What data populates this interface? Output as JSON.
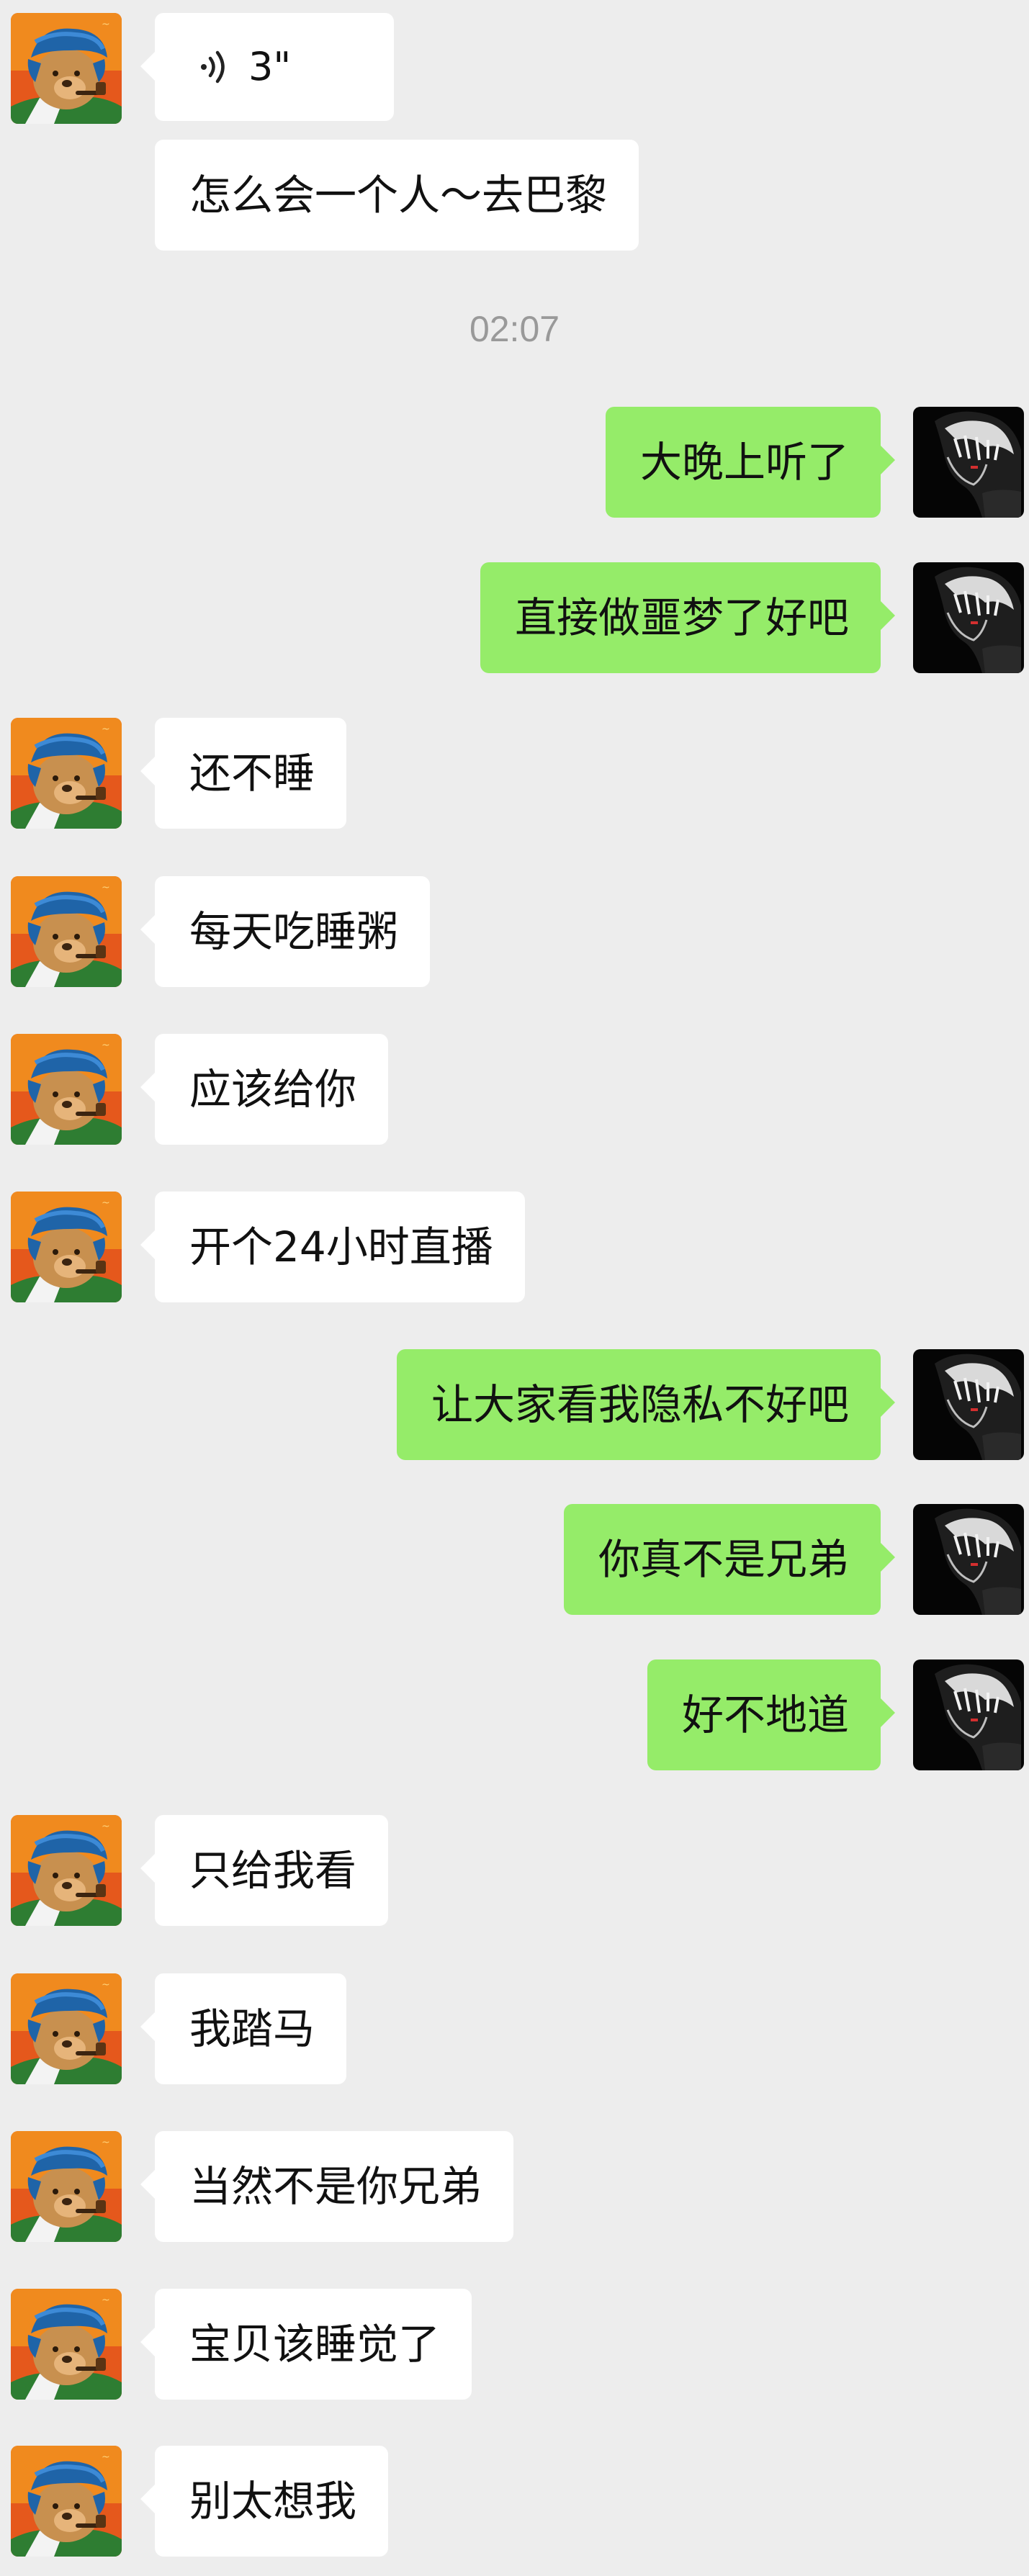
{
  "conversation": {
    "timestamp": "02:07",
    "voice_message": {
      "duration": "3\"",
      "icon": "voice-wave-icon"
    },
    "messages": [
      {
        "side": "left",
        "text": "怎么会一个人～去巴黎"
      },
      {
        "side": "right",
        "text": "大晚上听了"
      },
      {
        "side": "right",
        "text": "直接做噩梦了好吧"
      },
      {
        "side": "left",
        "text": "还不睡"
      },
      {
        "side": "left",
        "text": "每天吃睡粥"
      },
      {
        "side": "left",
        "text": "应该给你"
      },
      {
        "side": "left",
        "text": "开个24小时直播"
      },
      {
        "side": "right",
        "text": "让大家看我隐私不好吧"
      },
      {
        "side": "right",
        "text": "你真不是兄弟"
      },
      {
        "side": "right",
        "text": "好不地道"
      },
      {
        "side": "left",
        "text": "只给我看"
      },
      {
        "side": "left",
        "text": "我踏马"
      },
      {
        "side": "left",
        "text": "当然不是你兄弟"
      },
      {
        "side": "left",
        "text": "宝贝该睡觉了"
      },
      {
        "side": "left",
        "text": "别太想我"
      }
    ]
  },
  "colors": {
    "background": "#ededed",
    "incoming_bubble": "#ffffff",
    "outgoing_bubble": "#95ec69",
    "timestamp": "#999999"
  },
  "avatars": {
    "contact": "bear-with-pipe-avatar",
    "self": "dark-anime-boy-avatar"
  }
}
